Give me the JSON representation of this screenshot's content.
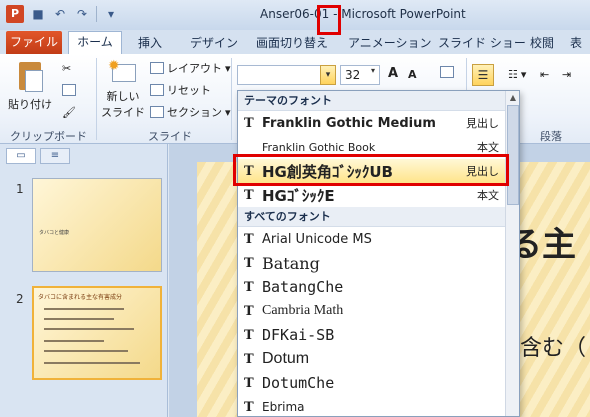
{
  "window": {
    "title": "Anser06-01 - Microsoft PowerPoint",
    "app_icon": "P"
  },
  "tabs": {
    "file": "ファイル",
    "items": [
      "ホーム",
      "挿入",
      "デザイン",
      "画面切り替え",
      "アニメーション",
      "スライド ショー",
      "校閲",
      "表示"
    ]
  },
  "ribbon": {
    "paste": "貼り付け",
    "clipboard_group": "クリップボード",
    "new_slide": "新しい\nスライド",
    "new_slide_line1": "新しい",
    "new_slide_line2": "スライド",
    "layout": "レイアウト",
    "reset": "リセット",
    "section": "セクション",
    "slides_group": "スライド",
    "font_size": "32",
    "grow": "A",
    "shrink": "A",
    "paragraph_group": "段落"
  },
  "slides_pane": {
    "thumbs": [
      {
        "number": "1",
        "title": "タバコと健康"
      },
      {
        "number": "2",
        "title": "タバコに含まれる主な有害成分"
      }
    ]
  },
  "slide_canvas": {
    "text1": "る主",
    "text2": "含む（"
  },
  "font_dropdown": {
    "theme_header": "テーマのフォント",
    "all_header": "すべてのフォント",
    "theme_fonts": [
      {
        "name": "Franklin Gothic Medium",
        "kind": "見出し"
      },
      {
        "name": "Franklin Gothic Book",
        "kind": "本文"
      },
      {
        "name": "HG創英角ｺﾞｼｯｸUB",
        "kind": "見出し"
      },
      {
        "name": "HGｺﾞｼｯｸE",
        "kind": "本文"
      }
    ],
    "all_fonts": [
      "Arial Unicode MS",
      "Batang",
      "BatangChe",
      "Cambria Math",
      "DFKai-SB",
      "Dotum",
      "DotumChe",
      "Ebrima"
    ]
  }
}
